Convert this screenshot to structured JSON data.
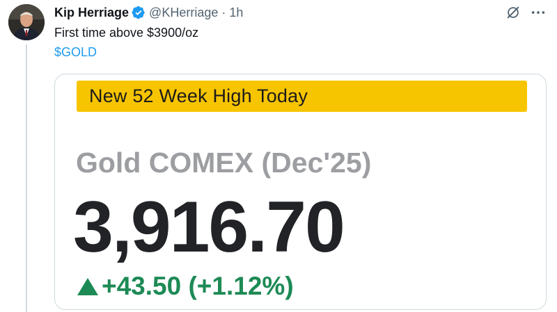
{
  "tweet": {
    "author_name": "Kip Herriage",
    "handle": "@KHerriage",
    "separator": "·",
    "time": "1h",
    "text": "First time above $3900/oz",
    "cashtag": "$GOLD"
  },
  "icons": {
    "verified": "verified-badge-icon",
    "grok": "grok-icon",
    "more": "more-icon"
  },
  "card": {
    "banner": "New 52 Week High Today",
    "instrument": "Gold COMEX (Dec'25)",
    "price": "3,916.70",
    "change": "+43.50 (+1.12%)"
  },
  "colors": {
    "verified": "#1d9bf0",
    "cashtag": "#1d9bf0",
    "banner_bg": "#f7c400",
    "change_green": "#1d8a55",
    "instrument_gray": "#9c9ea1"
  }
}
